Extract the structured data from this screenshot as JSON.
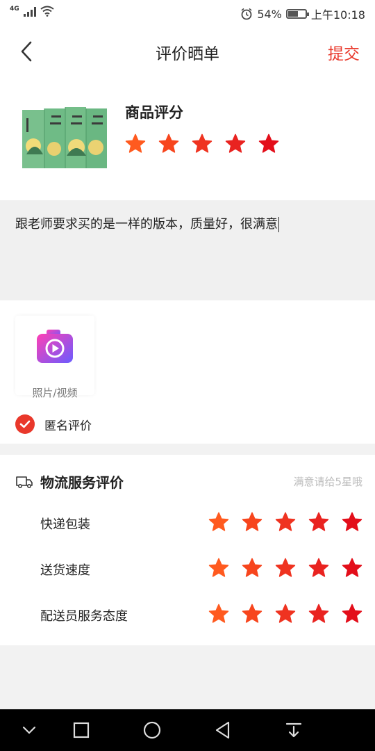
{
  "status_bar": {
    "network": "4G",
    "battery": "54%",
    "time": "上午10:18",
    "icons": [
      "signal-icon",
      "wifi-icon",
      "alarm-icon",
      "battery-icon"
    ]
  },
  "header": {
    "title": "评价晒单",
    "submit_label": "提交",
    "back_icon": "back-arrow-icon"
  },
  "product": {
    "rating_label": "商品评分",
    "rating": 5,
    "max_rating": 5
  },
  "comment": {
    "text": "跟老师要求买的是一样的版本，质量好，很满意"
  },
  "media": {
    "upload_label": "照片/视频",
    "icon": "camera-video-icon"
  },
  "anonymous": {
    "label": "匿名评价",
    "checked": true
  },
  "logistics": {
    "title": "物流服务评价",
    "hint": "满意请给5星哦",
    "icon": "truck-icon",
    "rows": [
      {
        "label": "快递包装",
        "rating": 5
      },
      {
        "label": "送货速度",
        "rating": 5
      },
      {
        "label": "配送员服务态度",
        "rating": 5
      }
    ]
  },
  "colors": {
    "accent": "#e9382b",
    "star_gradient": [
      "#ff5a1f",
      "#f7451d",
      "#ef3320",
      "#e92320",
      "#e30e1a"
    ]
  },
  "nav_bar": {
    "icons": [
      "hide-nav-icon",
      "recents-icon",
      "home-icon",
      "back-icon",
      "notification-pull-icon"
    ]
  }
}
